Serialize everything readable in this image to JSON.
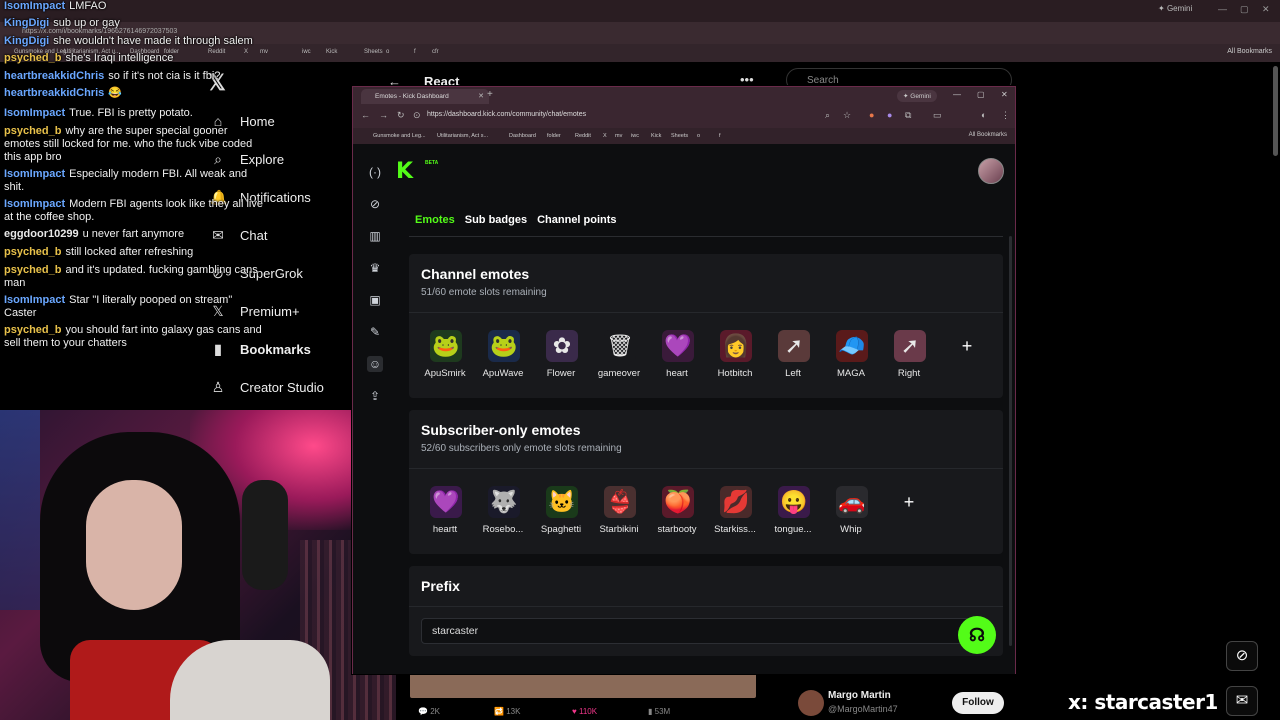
{
  "background_browser": {
    "url": "https://x.com/i/bookmarks/1966276146972037503",
    "gemini_label": "Gemini",
    "all_bookmarks_label": "All Bookmarks",
    "bookmarks": [
      "Gunsmoke and Leg...",
      "Utilitarianism, Act u...",
      "Dashboard",
      "folder",
      "Reddit",
      "X",
      "mv",
      "iwc",
      "Kick",
      "Sheets",
      "o",
      "f",
      "cfr"
    ]
  },
  "x_sidebar": {
    "items": [
      {
        "label": "Home",
        "icon": "home-icon"
      },
      {
        "label": "Explore",
        "icon": "search-icon"
      },
      {
        "label": "Notifications",
        "icon": "bell-icon"
      },
      {
        "label": "Chat",
        "icon": "chat-icon"
      },
      {
        "label": "SuperGrok",
        "icon": "grok-icon"
      },
      {
        "label": "Premium+",
        "icon": "x-icon"
      },
      {
        "label": "Bookmarks",
        "icon": "bookmark-icon"
      },
      {
        "label": "Creator Studio",
        "icon": "creator-icon"
      }
    ],
    "header_title": "React",
    "search_placeholder": "Search",
    "tweet_stats": [
      "2K",
      "13K",
      "110K",
      "53M"
    ],
    "profile_name": "Margo Martin",
    "profile_handle": "@MargoMartin47",
    "follow_label": "Follow"
  },
  "chat": {
    "messages": [
      {
        "user": "IsomImpact",
        "color": "#6aa7ff",
        "text": "LMFAO"
      },
      {
        "user": "KingDigi",
        "color": "#6aa7ff",
        "text": "sub up or gay"
      },
      {
        "user": "KingDigi",
        "color": "#6aa7ff",
        "text": "she wouldn't have made it through salem"
      },
      {
        "user": "psyched_b",
        "color": "#e8c14a",
        "text": "she's Iraqi intelligence"
      },
      {
        "user": "heartbreakkidChris",
        "color": "#6aa7ff",
        "text": "so if it's not cia is it fbi?"
      },
      {
        "user": "heartbreakkidChris",
        "color": "#6aa7ff",
        "text": "😂"
      },
      {
        "user": "IsomImpact",
        "color": "#6aa7ff",
        "text": "True. FBI is pretty potato."
      },
      {
        "user": "psyched_b",
        "color": "#e8c14a",
        "text": "why are the super special gooner emotes still locked for me. who the fuck vibe coded this app bro"
      },
      {
        "user": "IsomImpact",
        "color": "#6aa7ff",
        "text": "Especially modern FBI. All weak and shit."
      },
      {
        "user": "IsomImpact",
        "color": "#6aa7ff",
        "text": "Modern FBI agents look like they all live at the coffee shop."
      },
      {
        "user": "eggdoor10299",
        "color": "#e8e8e8",
        "text": "u never fart anymore"
      },
      {
        "user": "psyched_b",
        "color": "#e8c14a",
        "text": "still locked after refreshing"
      },
      {
        "user": "psyched_b",
        "color": "#e8c14a",
        "text": "and it's updated. fucking gambling cans man"
      },
      {
        "user": "IsomImpact",
        "color": "#6aa7ff",
        "text": "Star \"I literally pooped on stream\" Caster"
      },
      {
        "user": "psyched_b",
        "color": "#e8c14a",
        "text": "you should fart into galaxy gas cans and sell them to your chatters"
      }
    ]
  },
  "kick_window": {
    "tab_title": "Emotes - Kick Dashboard",
    "url": "https://dashboard.kick.com/community/chat/emotes",
    "gemini_label": "Gemini",
    "all_bookmarks_label": "All Bookmarks",
    "bookmarks": [
      "Gunsmoke and Leg...",
      "Utilitarianism, Act s...",
      "Dashboard",
      "folder",
      "Reddit",
      "X",
      "mv",
      "iwc",
      "Kick",
      "Sheets",
      "o",
      "f"
    ],
    "logo_text": "K",
    "beta_label": "BETA",
    "tabs": [
      "Emotes",
      "Sub badges",
      "Channel points"
    ],
    "channel_emotes": {
      "title": "Channel emotes",
      "subtitle": "51/60 emote slots remaining",
      "emotes": [
        {
          "name": "ApuSmirk",
          "glyph": "🐸",
          "bg": "#1e3a1e"
        },
        {
          "name": "ApuWave",
          "glyph": "🐸",
          "bg": "#1a2a4a"
        },
        {
          "name": "Flower",
          "glyph": "✿",
          "bg": "#3a2a4a"
        },
        {
          "name": "gameover",
          "glyph": "🗑",
          "bg": "#18191c"
        },
        {
          "name": "heart",
          "glyph": "💜",
          "bg": "#3a1a3a"
        },
        {
          "name": "Hotbitch",
          "glyph": "👩",
          "bg": "#5a1a2a"
        },
        {
          "name": "Left",
          "glyph": "➚",
          "bg": "#5a3a3a"
        },
        {
          "name": "MAGA",
          "glyph": "🧢",
          "bg": "#5a1a1a"
        },
        {
          "name": "Right",
          "glyph": "➚",
          "bg": "#6a3a4a"
        }
      ]
    },
    "subscriber_emotes": {
      "title": "Subscriber-only emotes",
      "subtitle": "52/60 subscribers only emote slots remaining",
      "emotes": [
        {
          "name": "heartt",
          "glyph": "💜",
          "bg": "#3a1a4a"
        },
        {
          "name": "Rosebo...",
          "glyph": "🐺",
          "bg": "#1a1a2a"
        },
        {
          "name": "Spaghetti",
          "glyph": "🐱",
          "bg": "#1a3a1a"
        },
        {
          "name": "Starbikini",
          "glyph": "👙",
          "bg": "#4a3030"
        },
        {
          "name": "starbooty",
          "glyph": "🍑",
          "bg": "#5a1a2a"
        },
        {
          "name": "Starkiss...",
          "glyph": "💋",
          "bg": "#4a2a2a"
        },
        {
          "name": "tongue...",
          "glyph": "😛",
          "bg": "#3a1a4a"
        },
        {
          "name": "Whip",
          "glyph": "🚗",
          "bg": "#2a2a2e"
        }
      ]
    },
    "prefix": {
      "title": "Prefix",
      "value": "starcaster"
    }
  },
  "overlay": {
    "handle": "x: starcaster1"
  },
  "colors": {
    "kick_green": "#53fc18",
    "window_border": "#6a2a4a"
  }
}
